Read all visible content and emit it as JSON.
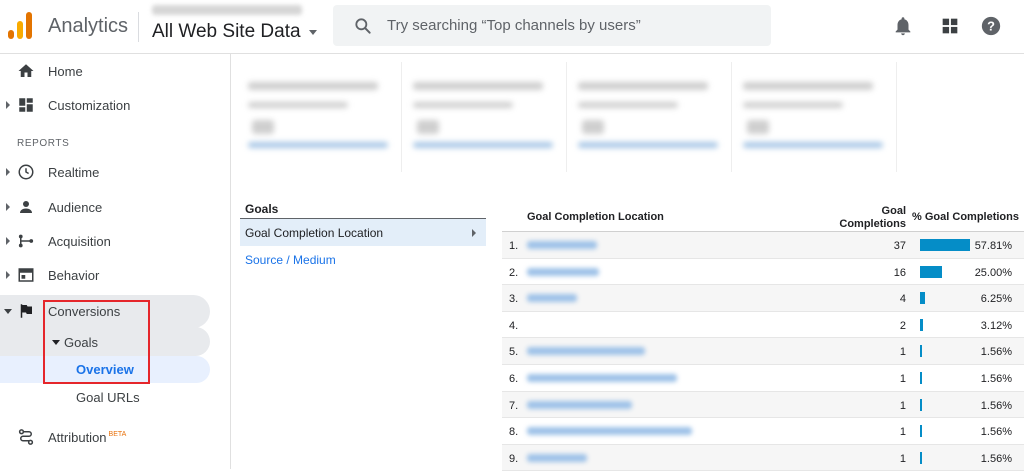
{
  "header": {
    "app_title": "Analytics",
    "property": "All Web Site Data",
    "search_placeholder": "Try searching “Top channels by users”",
    "icons": [
      "notifications-icon",
      "apps-grid-icon",
      "help-icon"
    ]
  },
  "sidebar": {
    "items": [
      {
        "label": "Home",
        "icon": "home-icon"
      },
      {
        "label": "Customization",
        "icon": "dashboard-icon"
      }
    ],
    "reports_heading": "REPORTS",
    "reports": [
      {
        "label": "Realtime",
        "icon": "clock-icon"
      },
      {
        "label": "Audience",
        "icon": "person-icon"
      },
      {
        "label": "Acquisition",
        "icon": "acquisition-icon"
      },
      {
        "label": "Behavior",
        "icon": "behavior-icon"
      },
      {
        "label": "Conversions",
        "icon": "flag-icon"
      }
    ],
    "goals_label": "Goals",
    "overview_label": "Overview",
    "goal_urls_label": "Goal URLs",
    "attribution_label": "Attribution",
    "beta_badge": "BETA"
  },
  "goals_panel": {
    "heading": "Goals",
    "active_dimension": "Goal Completion Location",
    "other_dimension": "Source / Medium"
  },
  "table": {
    "col_location": "Goal Completion Location",
    "col_completions_line1": "Goal",
    "col_completions_line2": "Completions",
    "col_percent": "% Goal Completions",
    "bar_color": "#058dc7",
    "rows": [
      {
        "num": "1.",
        "completions": "37",
        "percent": "57.81%",
        "share": 0.5781
      },
      {
        "num": "2.",
        "completions": "16",
        "percent": "25.00%",
        "share": 0.25
      },
      {
        "num": "3.",
        "completions": "4",
        "percent": "6.25%",
        "share": 0.0625
      },
      {
        "num": "4.",
        "completions": "2",
        "percent": "3.12%",
        "share": 0.0312
      },
      {
        "num": "5.",
        "completions": "1",
        "percent": "1.56%",
        "share": 0.0156
      },
      {
        "num": "6.",
        "completions": "1",
        "percent": "1.56%",
        "share": 0.0156
      },
      {
        "num": "7.",
        "completions": "1",
        "percent": "1.56%",
        "share": 0.0156
      },
      {
        "num": "8.",
        "completions": "1",
        "percent": "1.56%",
        "share": 0.0156
      },
      {
        "num": "9.",
        "completions": "1",
        "percent": "1.56%",
        "share": 0.0156
      }
    ]
  },
  "colors": {
    "accent_blue": "#1a73e8",
    "highlight_box": "#e5262b"
  }
}
